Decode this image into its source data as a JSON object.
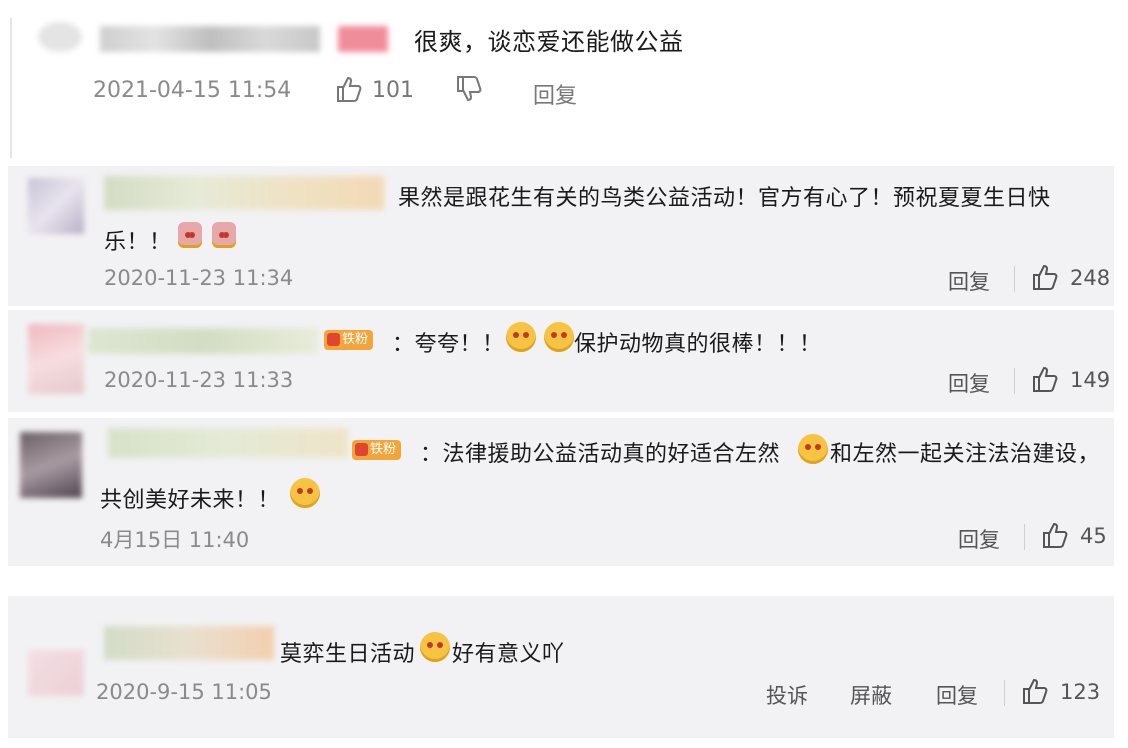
{
  "comments": [
    {
      "text": "很爽，谈恋爱还能做公益",
      "time": "2021-04-15 11:54",
      "likes": "101",
      "reply": "回复"
    },
    {
      "text_line1": "果然是跟花生有关的鸟类公益活动！官方有心了！预祝夏夏生日快",
      "text_line2": "乐！！",
      "time": "2020-11-23 11:34",
      "reply": "回复",
      "likes": "248"
    },
    {
      "badge": "铁粉",
      "text_a": "：夸夸！！",
      "text_b": "保护动物真的很棒！！！",
      "time": "2020-11-23 11:33",
      "reply": "回复",
      "likes": "149"
    },
    {
      "badge": "铁粉",
      "text_a": "：法律援助公益活动真的好适合左然",
      "text_b": "和左然一起关注法治建设，",
      "text_line2": "共创美好未来！！",
      "time": "4月15日 11:40",
      "reply": "回复",
      "likes": "45"
    },
    {
      "text_a": "莫弈生日活动",
      "text_b": "好有意义吖",
      "time": "2020-9-15 11:05",
      "report": "投诉",
      "block": "屏蔽",
      "reply": "回复",
      "likes": "123"
    }
  ],
  "colors": {
    "panel": "#f2f2f4",
    "text": "#1a1a1a",
    "meta": "#8a8a8a",
    "badge": "#f3a53a",
    "emoji": "#f6c343"
  },
  "icons": [
    "thumb-up-icon",
    "thumb-down-icon",
    "emoji-face-icon",
    "fan-badge-icon"
  ]
}
